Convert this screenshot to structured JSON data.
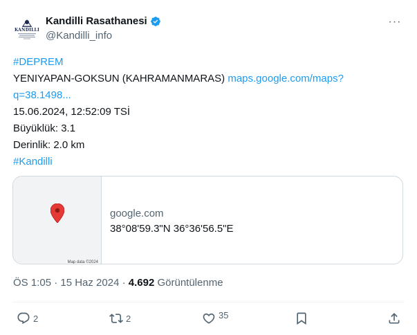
{
  "author": {
    "display_name": "Kandilli Rasathanesi",
    "handle": "@Kandilli_info",
    "verified": true,
    "avatar_logo_text": "KANDILLI",
    "verified_color": "#1d9bf0"
  },
  "more_label": "···",
  "tweet": {
    "hashtag1": "#DEPREM",
    "location": "YENIYAPAN-GOKSUN (KAHRAMANMARAS)",
    "link_part1": "maps.google.com/maps?",
    "link_part2": "q=38.1498...",
    "datetime": "15.06.2024, 12:52:09 TSİ",
    "magnitude": "Büyüklük: 3.1",
    "depth": "Derinlik: 2.0 km",
    "hashtag2": "#Kandilli"
  },
  "card": {
    "domain": "google.com",
    "title": "38°08'59.3\"N 36°36'56.5\"E",
    "map_attribution": "Map data ©2024",
    "pin_color": "#e53935"
  },
  "meta": {
    "date": "ÖS 1:05 · 15 Haz 2024 · ",
    "views_count": "4.692",
    "views_label": " Görüntülenme"
  },
  "actions": {
    "replies": "2",
    "retweets": "2",
    "likes": "35"
  },
  "colors": {
    "link": "#1d9bf0",
    "secondary_text": "#536471",
    "border": "#cfd9de"
  }
}
